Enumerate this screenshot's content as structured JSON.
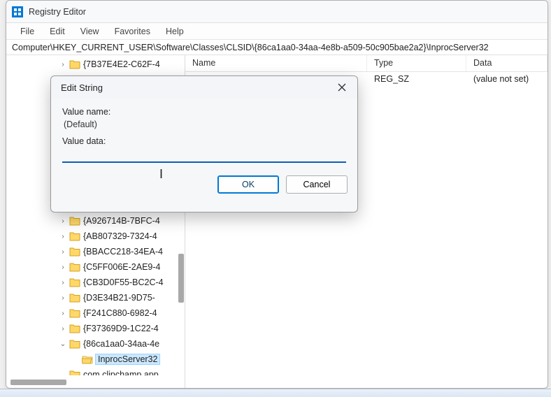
{
  "title": "Registry Editor",
  "menu": {
    "file": "File",
    "edit": "Edit",
    "view": "View",
    "favorites": "Favorites",
    "help": "Help"
  },
  "address": "Computer\\HKEY_CURRENT_USER\\Software\\Classes\\CLSID\\{86ca1aa0-34aa-4e8b-a509-50c905bae2a2}\\InprocServer32",
  "columns": {
    "name": "Name",
    "type": "Type",
    "data": "Data"
  },
  "rows": [
    {
      "name": "",
      "type": "REG_SZ",
      "data": "(value not set)"
    }
  ],
  "tree": {
    "items": [
      {
        "label": "{7B37E4E2-C62F-4",
        "depth": 3,
        "expander": ">"
      },
      {
        "label": "{A926714B-7BFC-4",
        "depth": 3,
        "expander": ">"
      },
      {
        "label": "{AB807329-7324-4",
        "depth": 3,
        "expander": ">"
      },
      {
        "label": "{BBACC218-34EA-4",
        "depth": 3,
        "expander": ">"
      },
      {
        "label": "{C5FF006E-2AE9-4",
        "depth": 3,
        "expander": ">"
      },
      {
        "label": "{CB3D0F55-BC2C-4",
        "depth": 3,
        "expander": ">"
      },
      {
        "label": "{D3E34B21-9D75-",
        "depth": 3,
        "expander": ">"
      },
      {
        "label": "{F241C880-6982-4",
        "depth": 3,
        "expander": ">"
      },
      {
        "label": "{F37369D9-1C22-4",
        "depth": 3,
        "expander": ">"
      },
      {
        "label": "{86ca1aa0-34aa-4e",
        "depth": 3,
        "expander": "v",
        "expanded": true
      },
      {
        "label": "InprocServer32",
        "depth": 4,
        "expander": "",
        "selected": true,
        "open": true
      },
      {
        "label": "com.clipchamp.app",
        "depth": 3,
        "expander": ""
      }
    ]
  },
  "dialog": {
    "title": "Edit String",
    "value_name_label": "Value name:",
    "value_name": "(Default)",
    "value_data_label": "Value data:",
    "value_data": "",
    "ok": "OK",
    "cancel": "Cancel"
  }
}
